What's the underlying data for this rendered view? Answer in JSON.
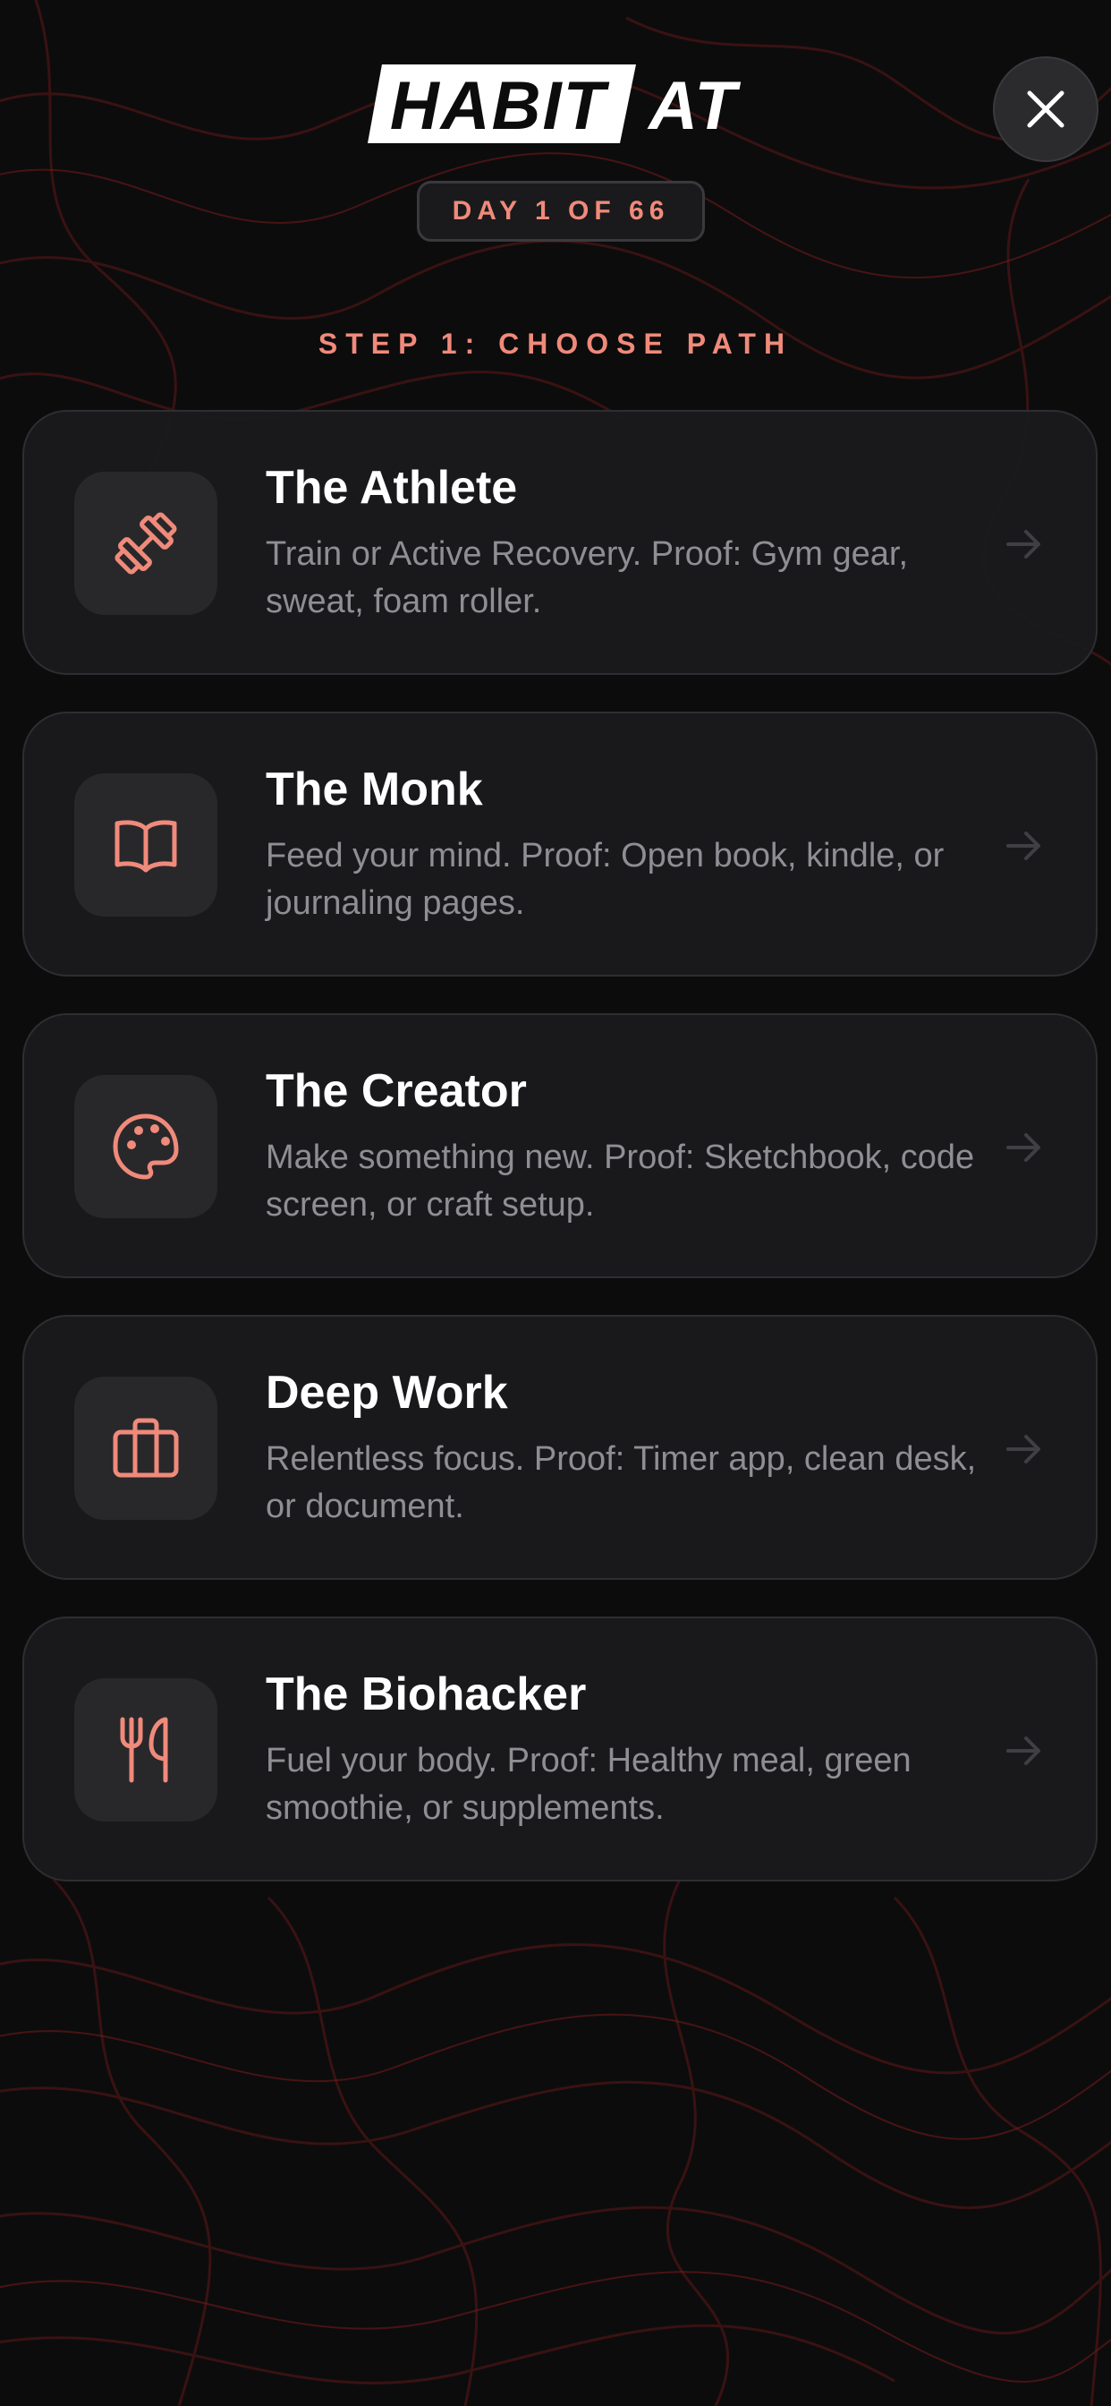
{
  "header": {
    "logo_text_left": "HABIT",
    "logo_text_right": "AT",
    "day_label": "DAY 1 OF 66",
    "close_icon": "close-icon"
  },
  "step": {
    "title": "STEP 1: CHOOSE PATH"
  },
  "paths": [
    {
      "title": "The Athlete",
      "description": "Train or Active Recovery. Proof: Gym gear, sweat, foam roller.",
      "icon": "dumbbell-icon"
    },
    {
      "title": "The Monk",
      "description": "Feed your mind. Proof: Open book, kindle, or journaling pages.",
      "icon": "book-icon"
    },
    {
      "title": "The Creator",
      "description": "Make something new. Proof: Sketchbook, code screen, or craft setup.",
      "icon": "palette-icon"
    },
    {
      "title": "Deep Work",
      "description": "Relentless focus. Proof: Timer app, clean desk, or document.",
      "icon": "briefcase-icon"
    },
    {
      "title": "The Biohacker",
      "description": "Fuel your body. Proof: Healthy meal, green smoothie, or supplements.",
      "icon": "utensils-icon"
    }
  ],
  "colors": {
    "background": "#0c0c0d",
    "accent": "#f08a7a",
    "card": "#1a1a1d",
    "icon_tile": "#28282b",
    "topo_lines": "#5a1717"
  }
}
